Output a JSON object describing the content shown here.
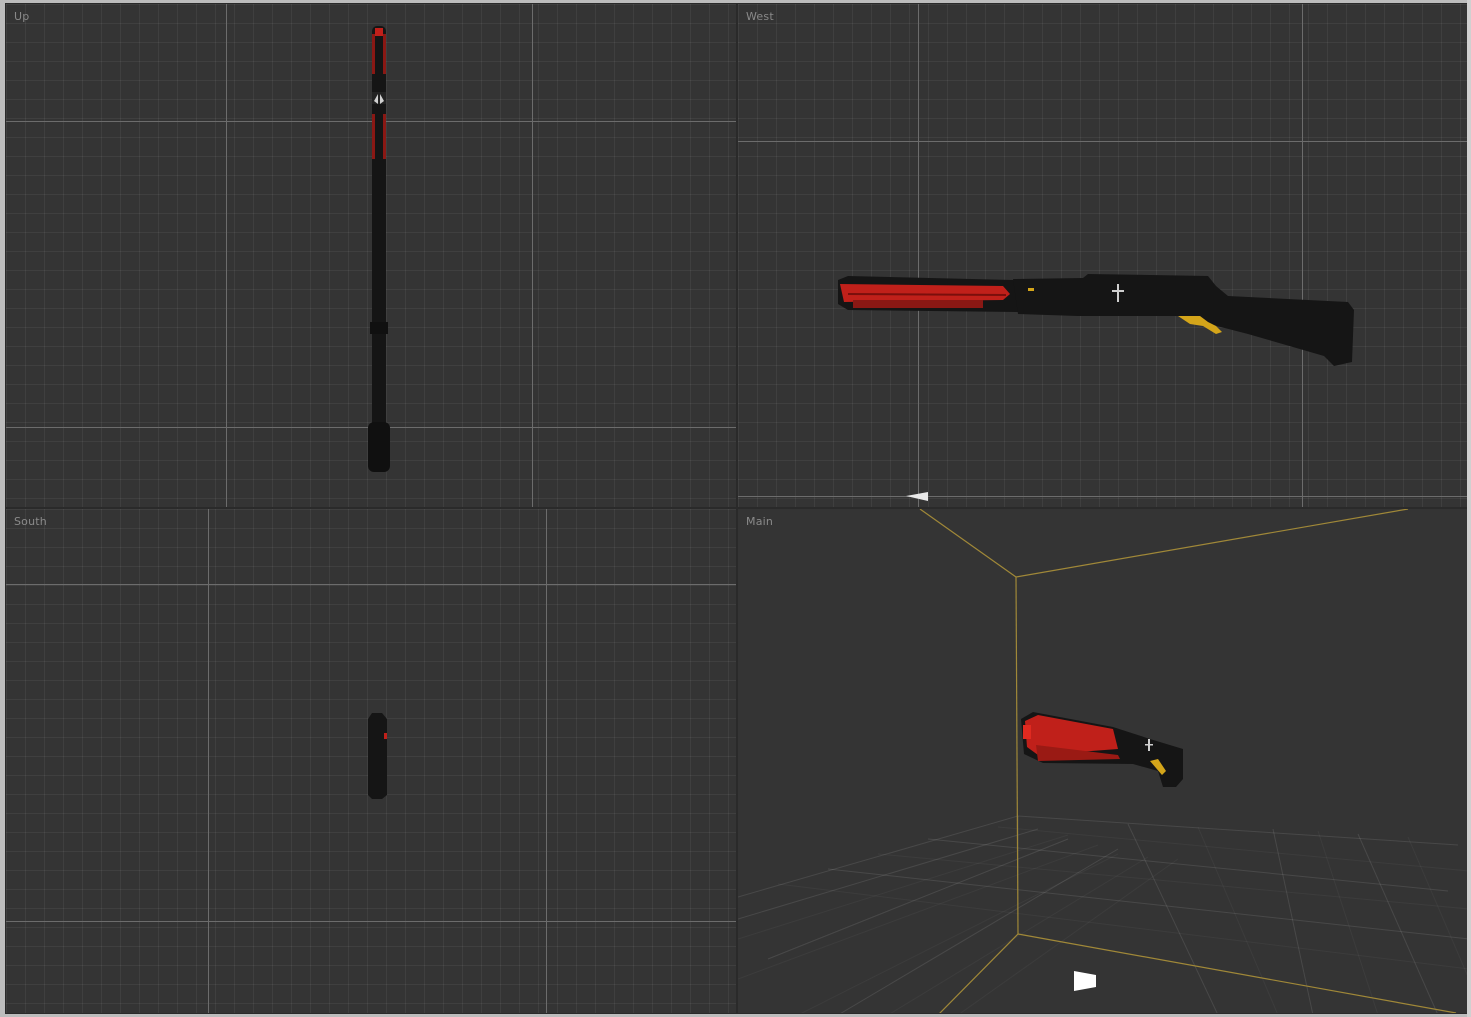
{
  "viewports": {
    "up": {
      "label": "Up"
    },
    "west": {
      "label": "West"
    },
    "south": {
      "label": "South"
    },
    "main": {
      "label": "Main"
    }
  },
  "icons": {
    "camera_west": "camera-icon",
    "camera_main": "camera-icon",
    "pivot_west": "pivot-cross-icon"
  },
  "colors": {
    "background": "#343434",
    "grid_major": "#6c6c6c",
    "model_body": "#151515",
    "model_accent": "#c0201a",
    "model_trim": "#d4a51a",
    "bounding_box": "#a08838"
  }
}
